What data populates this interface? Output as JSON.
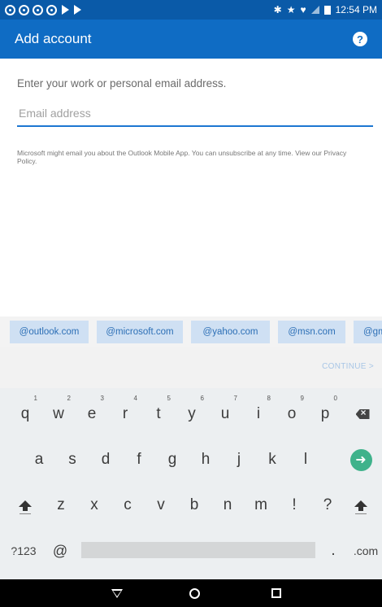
{
  "status_bar": {
    "time": "12:54 PM",
    "notification_icons": [
      "notification-icon",
      "notification-icon",
      "notification-icon",
      "notification-icon",
      "play-store-icon",
      "play-store-icon"
    ],
    "system_icons": [
      "bluetooth-icon",
      "star-icon",
      "wifi-icon",
      "signal-icon",
      "battery-icon"
    ]
  },
  "app_bar": {
    "title": "Add account",
    "help_icon": "help-icon"
  },
  "form": {
    "prompt": "Enter your work or personal email address.",
    "email_placeholder": "Email address",
    "email_value": "",
    "disclaimer": "Microsoft might email you about the Outlook Mobile App. You can unsubscribe at any time. View our",
    "privacy_link": "Privacy Policy."
  },
  "suggestions": [
    "@outlook.com",
    "@microsoft.com",
    "@yahoo.com",
    "@msn.com",
    "@gma"
  ],
  "continue_label": "CONTINUE >",
  "keyboard": {
    "row1": [
      {
        "key": "q",
        "hint": "1"
      },
      {
        "key": "w",
        "hint": "2"
      },
      {
        "key": "e",
        "hint": "3"
      },
      {
        "key": "r",
        "hint": "4"
      },
      {
        "key": "t",
        "hint": "5"
      },
      {
        "key": "y",
        "hint": "6"
      },
      {
        "key": "u",
        "hint": "7"
      },
      {
        "key": "i",
        "hint": "8"
      },
      {
        "key": "o",
        "hint": "9"
      },
      {
        "key": "p",
        "hint": "0"
      }
    ],
    "row2": [
      "a",
      "s",
      "d",
      "f",
      "g",
      "h",
      "j",
      "k",
      "l"
    ],
    "row3": [
      "z",
      "x",
      "c",
      "v",
      "b",
      "n",
      "m",
      "!",
      "?"
    ],
    "symbols_key": "?123",
    "at_key": "@",
    "period_key": ".",
    "com_key": ".com"
  },
  "colors": {
    "status_bar": "#0a5aa8",
    "app_bar": "#0f6cc4",
    "input_underline": "#1d77d2",
    "chip_bg": "#cfe0f3",
    "chip_text": "#2c6fb6",
    "enter_key": "#3fb28b"
  }
}
